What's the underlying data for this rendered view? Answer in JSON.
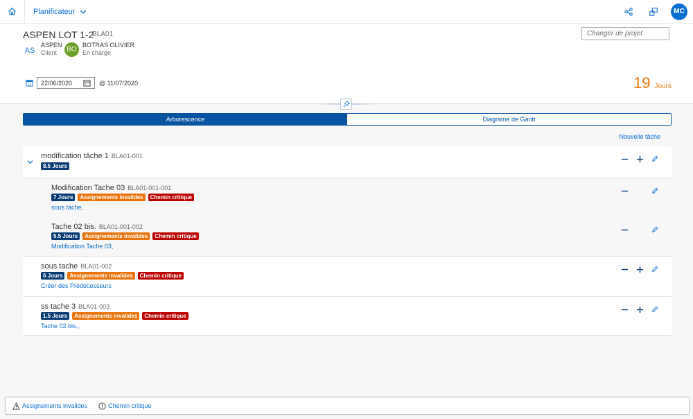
{
  "shell": {
    "app_title": "Planificateur",
    "user_initials": "MC"
  },
  "project": {
    "title": "ASPEN LOT 1-2",
    "code": "BLA01",
    "change_placeholder": "Changer de projet",
    "client": {
      "initials": "AS",
      "name": "ASPEN",
      "role": "Client"
    },
    "owner": {
      "initials": "BO",
      "name": "BOTRAS OLIVIER",
      "role": "En charge"
    },
    "start_date": "22/06/2020",
    "end_date": "@ 11/07/2020",
    "duration_value": "19",
    "duration_unit": "Jours"
  },
  "tabs": [
    "Arborescence",
    "Diagrame de Gantt"
  ],
  "new_task_label": "Nouvelle tâche",
  "tasks": [
    {
      "title": "modification tâche 1",
      "code": "BLA01-001",
      "days": "8.5 Jours"
    },
    {
      "title": "Modification Tache 03",
      "code": "BLA01-001-001",
      "days": "7 Jours",
      "warn": "Assignements invalides",
      "crit": "Chemin critique",
      "link": "sous tache,"
    },
    {
      "title": "Tache 02 bis.",
      "code": "BLA01-001-002",
      "days": "5.5 Jours",
      "warn": "Assignements invalides",
      "crit": "Chemin critique",
      "link": "Modification Tache 03,"
    },
    {
      "title": "sous tache",
      "code": "BLA01-002",
      "days": "6 Jours",
      "warn": "Assignements invalides",
      "crit": "Chemin critique",
      "link": "Créer des Prédecesseurs"
    },
    {
      "title": "ss tache 3",
      "code": "BLA01-003",
      "days": "1.5 Jours",
      "warn": "Assignements invalides",
      "crit": "Chemin critique",
      "link": "Tache 02 bis.,"
    }
  ],
  "footer": {
    "warn_label": "Assignements invalides",
    "crit_label": "Chemin critique"
  },
  "colors": {
    "brand": "#0a6ed1",
    "segment": "#0854a0",
    "days_badge": "#0a3b73",
    "warn_badge": "#e9730c",
    "crit_badge": "#bb0000",
    "duration": "#e9730c",
    "owner_avatar": "#6a9f28"
  },
  "icons": [
    "home-icon",
    "chevron-down-icon",
    "share-icon",
    "switch-app-icon",
    "calendar-icon",
    "date-picker-icon",
    "pin-icon",
    "minus-icon",
    "plus-icon",
    "edit-icon",
    "warning-icon",
    "alert-icon"
  ]
}
